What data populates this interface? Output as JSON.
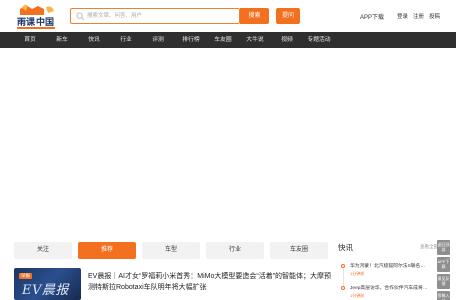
{
  "logo": {
    "text": "雨课中国",
    "subtitle": "www.ekuvv.com"
  },
  "search": {
    "placeholder": "搜索文章、问答、用户",
    "button_label": "搜索"
  },
  "header": {
    "publish_label": "提问",
    "app_download": "APP下载",
    "login": "登录",
    "register": "注册",
    "post": "投稿"
  },
  "nav": [
    "首页",
    "新车",
    "快讯",
    "行业",
    "评测",
    "排行榜",
    "车友圈",
    "大牛说",
    "视频",
    "专题活动"
  ],
  "tabs": [
    {
      "label": "关注",
      "active": false
    },
    {
      "label": "推荐",
      "active": true
    },
    {
      "label": "车型",
      "active": false
    },
    {
      "label": "行业",
      "active": false
    },
    {
      "label": "车友圈",
      "active": false
    }
  ],
  "news": {
    "thumb_tag": "早报",
    "thumb_text": "EV晨报",
    "title": "EV晨报｜AI才女“罗福莉小米首秀：MiMo大模型要造会“活着”的智能体；大摩预测特斯拉Robotaxi车队明年将大幅扩张",
    "meta": ""
  },
  "kuaixun": {
    "title": "快讯",
    "more": "查看全部",
    "items": [
      {
        "text": "华为鸿蒙！北汽极狐阿尔法S联名…",
        "time": "1分钟前"
      },
      {
        "text": "Jeep高层访华，合作伙伴汽车成将…",
        "time": "1分钟前"
      }
    ]
  },
  "side_float": [
    "返回顶部",
    "APP下载",
    "意见反馈",
    "投稿入口",
    "联系我们"
  ],
  "colors": {
    "accent": "#f37021",
    "nav_bg": "#2f2f2f"
  }
}
